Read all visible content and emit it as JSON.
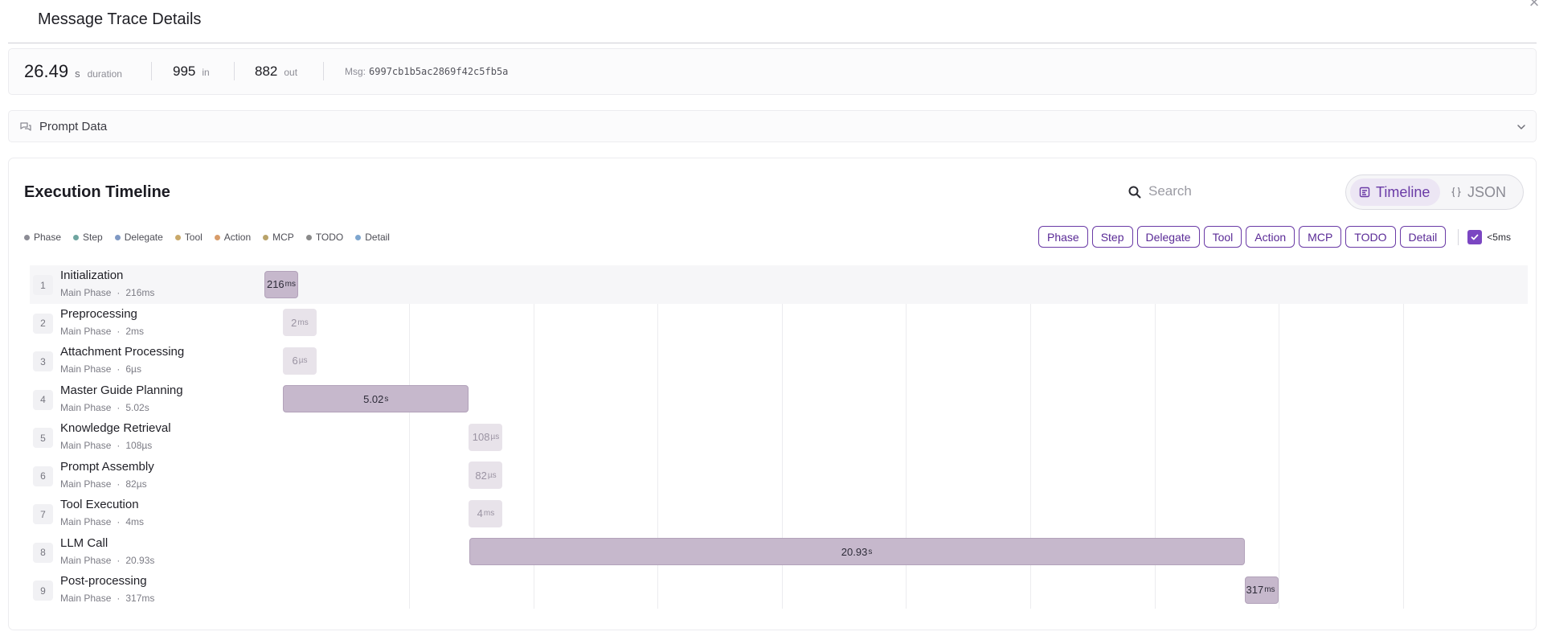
{
  "modal": {
    "title": "Message Trace Details",
    "close_glyph": "×"
  },
  "stats": {
    "duration_value": "26.49",
    "duration_unit": "s",
    "duration_caption": "duration",
    "in_value": "995",
    "in_caption": "in",
    "out_value": "882",
    "out_caption": "out",
    "msg_label": "Msg:",
    "msg_id": "6997cb1b5ac2869f42c5fb5a"
  },
  "prompt": {
    "label": "Prompt Data",
    "icon": "chat-bubbles-icon"
  },
  "timeline": {
    "title": "Execution Timeline",
    "search_placeholder": "Search",
    "view_timeline": "Timeline",
    "view_json": "JSON",
    "legend": [
      {
        "label": "Phase",
        "color": "#8c8c95"
      },
      {
        "label": "Step",
        "color": "#6fa5a0"
      },
      {
        "label": "Delegate",
        "color": "#7f99c4"
      },
      {
        "label": "Tool",
        "color": "#c9a96a"
      },
      {
        "label": "Action",
        "color": "#d89c6a"
      },
      {
        "label": "MCP",
        "color": "#b9a36a"
      },
      {
        "label": "TODO",
        "color": "#8a8a8a"
      },
      {
        "label": "Detail",
        "color": "#7ea6cf"
      }
    ],
    "filters": [
      "Phase",
      "Step",
      "Delegate",
      "Tool",
      "Action",
      "MCP",
      "TODO",
      "Detail"
    ],
    "short_label": "<5ms",
    "short_checked": true,
    "phases": [
      {
        "num": "1",
        "name": "Initialization",
        "type": "Main Phase",
        "dur": "216ms",
        "bar_value": "216",
        "bar_unit": "ms",
        "start_s": 0,
        "duration_s": 0.216,
        "style": "medium"
      },
      {
        "num": "2",
        "name": "Preprocessing",
        "type": "Main Phase",
        "dur": "2ms",
        "bar_value": "2",
        "bar_unit": "ms",
        "start_s": 0.216,
        "duration_s": 0.002,
        "style": "light"
      },
      {
        "num": "3",
        "name": "Attachment Processing",
        "type": "Main Phase",
        "dur": "6µs",
        "bar_value": "6",
        "bar_unit": "µs",
        "start_s": 0.218,
        "duration_s": 6e-06,
        "style": "light"
      },
      {
        "num": "4",
        "name": "Master Guide Planning",
        "type": "Main Phase",
        "dur": "5.02s",
        "bar_value": "5.02",
        "bar_unit": "s",
        "start_s": 0.218,
        "duration_s": 5.02,
        "style": "medium"
      },
      {
        "num": "5",
        "name": "Knowledge Retrieval",
        "type": "Main Phase",
        "dur": "108µs",
        "bar_value": "108",
        "bar_unit": "µs",
        "start_s": 5.238,
        "duration_s": 0.000108,
        "style": "light"
      },
      {
        "num": "6",
        "name": "Prompt Assembly",
        "type": "Main Phase",
        "dur": "82µs",
        "bar_value": "82",
        "bar_unit": "µs",
        "start_s": 5.238,
        "duration_s": 8.2e-05,
        "style": "light"
      },
      {
        "num": "7",
        "name": "Tool Execution",
        "type": "Main Phase",
        "dur": "4ms",
        "bar_value": "4",
        "bar_unit": "ms",
        "start_s": 5.238,
        "duration_s": 0.004,
        "style": "light"
      },
      {
        "num": "8",
        "name": "LLM Call",
        "type": "Main Phase",
        "dur": "20.93s",
        "bar_value": "20.93",
        "bar_unit": "s",
        "start_s": 5.242,
        "duration_s": 20.93,
        "style": "medium"
      },
      {
        "num": "9",
        "name": "Post-processing",
        "type": "Main Phase",
        "dur": "317ms",
        "bar_value": "317",
        "bar_unit": "ms",
        "start_s": 26.172,
        "duration_s": 0.317,
        "style": "medium"
      }
    ]
  }
}
